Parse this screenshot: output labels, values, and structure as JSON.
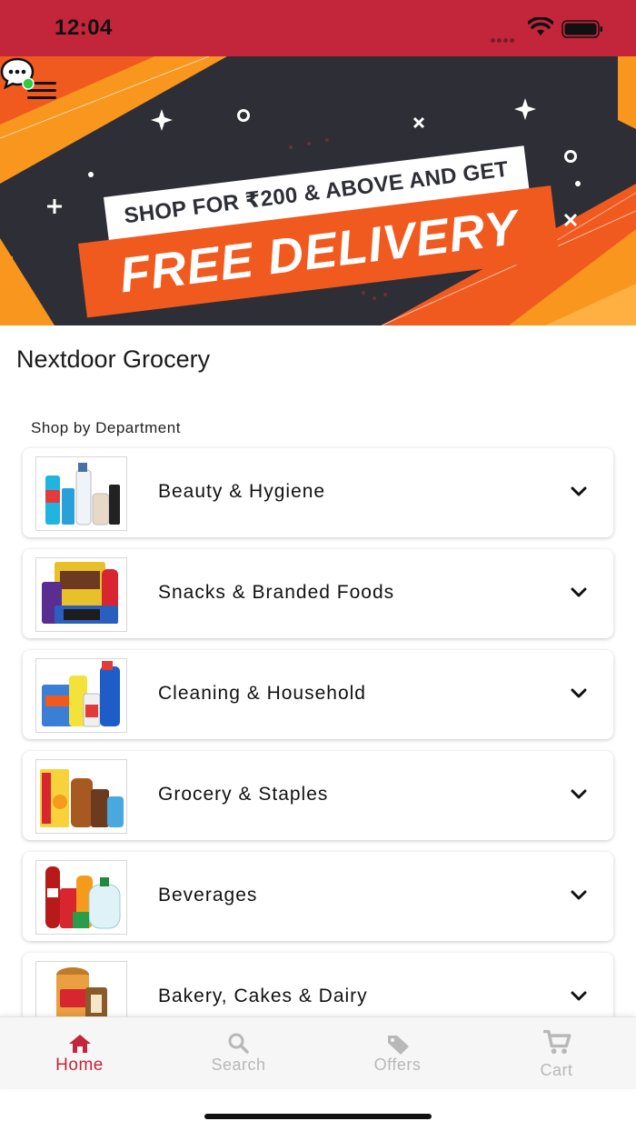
{
  "status_bar": {
    "time": "12:04"
  },
  "banner": {
    "line1": "SHOP FOR ₹200 & ABOVE AND GET",
    "line2": "FREE DELIVERY",
    "colors": {
      "dark": "#2e2f36",
      "orange": "#f15a1f",
      "accent": "#f8961e"
    }
  },
  "header": {
    "menu_icon": "hamburger-icon",
    "chat_icon": "chat-bubble-icon",
    "chat_badge_color": "#2ecc40"
  },
  "store": {
    "title": "Nextdoor Grocery"
  },
  "departments": {
    "section_label": "Shop by Department",
    "items": [
      {
        "label": "Beauty & Hygiene",
        "thumb": "beauty-products"
      },
      {
        "label": "Snacks & Branded Foods",
        "thumb": "snacks-products"
      },
      {
        "label": "Cleaning & Household",
        "thumb": "cleaning-products"
      },
      {
        "label": "Grocery & Staples",
        "thumb": "grocery-products"
      },
      {
        "label": "Beverages",
        "thumb": "beverage-products"
      },
      {
        "label": "Bakery, Cakes & Dairy",
        "thumb": "bakery-products"
      }
    ]
  },
  "tabs": [
    {
      "label": "Home",
      "icon": "home-icon",
      "active": true
    },
    {
      "label": "Search",
      "icon": "search-icon",
      "active": false
    },
    {
      "label": "Offers",
      "icon": "tag-icon",
      "active": false
    },
    {
      "label": "Cart",
      "icon": "cart-icon",
      "active": false
    }
  ],
  "theme": {
    "brand": "#c3253a",
    "inactive_tab": "#b8b8b8"
  }
}
